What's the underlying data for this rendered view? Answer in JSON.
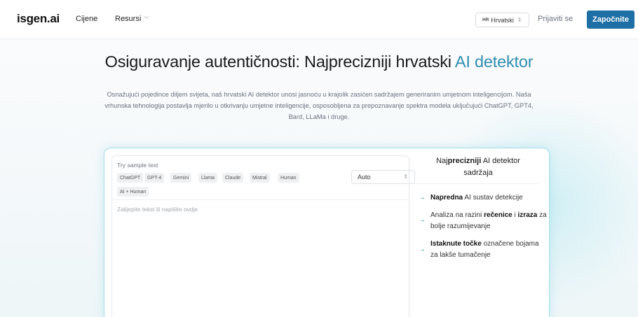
{
  "nav": {
    "logo": "isgen.ai",
    "pricing": "Cijene",
    "resources": "Resursi",
    "language_flag": "HR",
    "language": "Hrvatski",
    "login": "Prijaviti se",
    "start": "Započnite"
  },
  "hero": {
    "title_main": "Osiguravanje autentičnosti: Najprecizniji hrvatski ",
    "title_accent": "AI detektor",
    "description": "Osnažujući pojedince diljem svijeta, naš hrvatski AI detektor unosi jasnoću u krajolik zasićen sadržajem generiranim umjetnom inteligencijom. Naša vrhunska tehnologija postavlja mjerilo u otkrivanju umjetne inteligencije, osposobljena za prepoznavanje spektra modela uključujući ChatGPT, GPT4, Bard, LLaMa i druge."
  },
  "editor": {
    "sample_label": "Try sample text",
    "chips": [
      "ChatGPT",
      "GPT-4",
      "Gemini",
      "Llama",
      "Claude",
      "Mistral",
      "Human",
      "AI + Human"
    ],
    "mode_value": "Auto",
    "placeholder": "Zalijepite tekst ili napišite ovdje"
  },
  "info": {
    "title_pre": "Naj",
    "title_bold": "precizniji",
    "title_post": " AI detektor sadržaja",
    "items": [
      {
        "bold1": "Napredna",
        "text1": " AI sustav detekcije"
      },
      {
        "text1": "Analiza na razini ",
        "bold1": "rečenice",
        "text2": " i ",
        "bold2": "izraza",
        "text3": " za bolje razumijevanje"
      },
      {
        "bold1": "Istaknute točke",
        "text1": " označene bojama za lakše tumačenje"
      }
    ]
  },
  "colors": {
    "accent": "#2e8fb0",
    "button": "#1d6fa5",
    "card_border": "#a7dde8"
  }
}
